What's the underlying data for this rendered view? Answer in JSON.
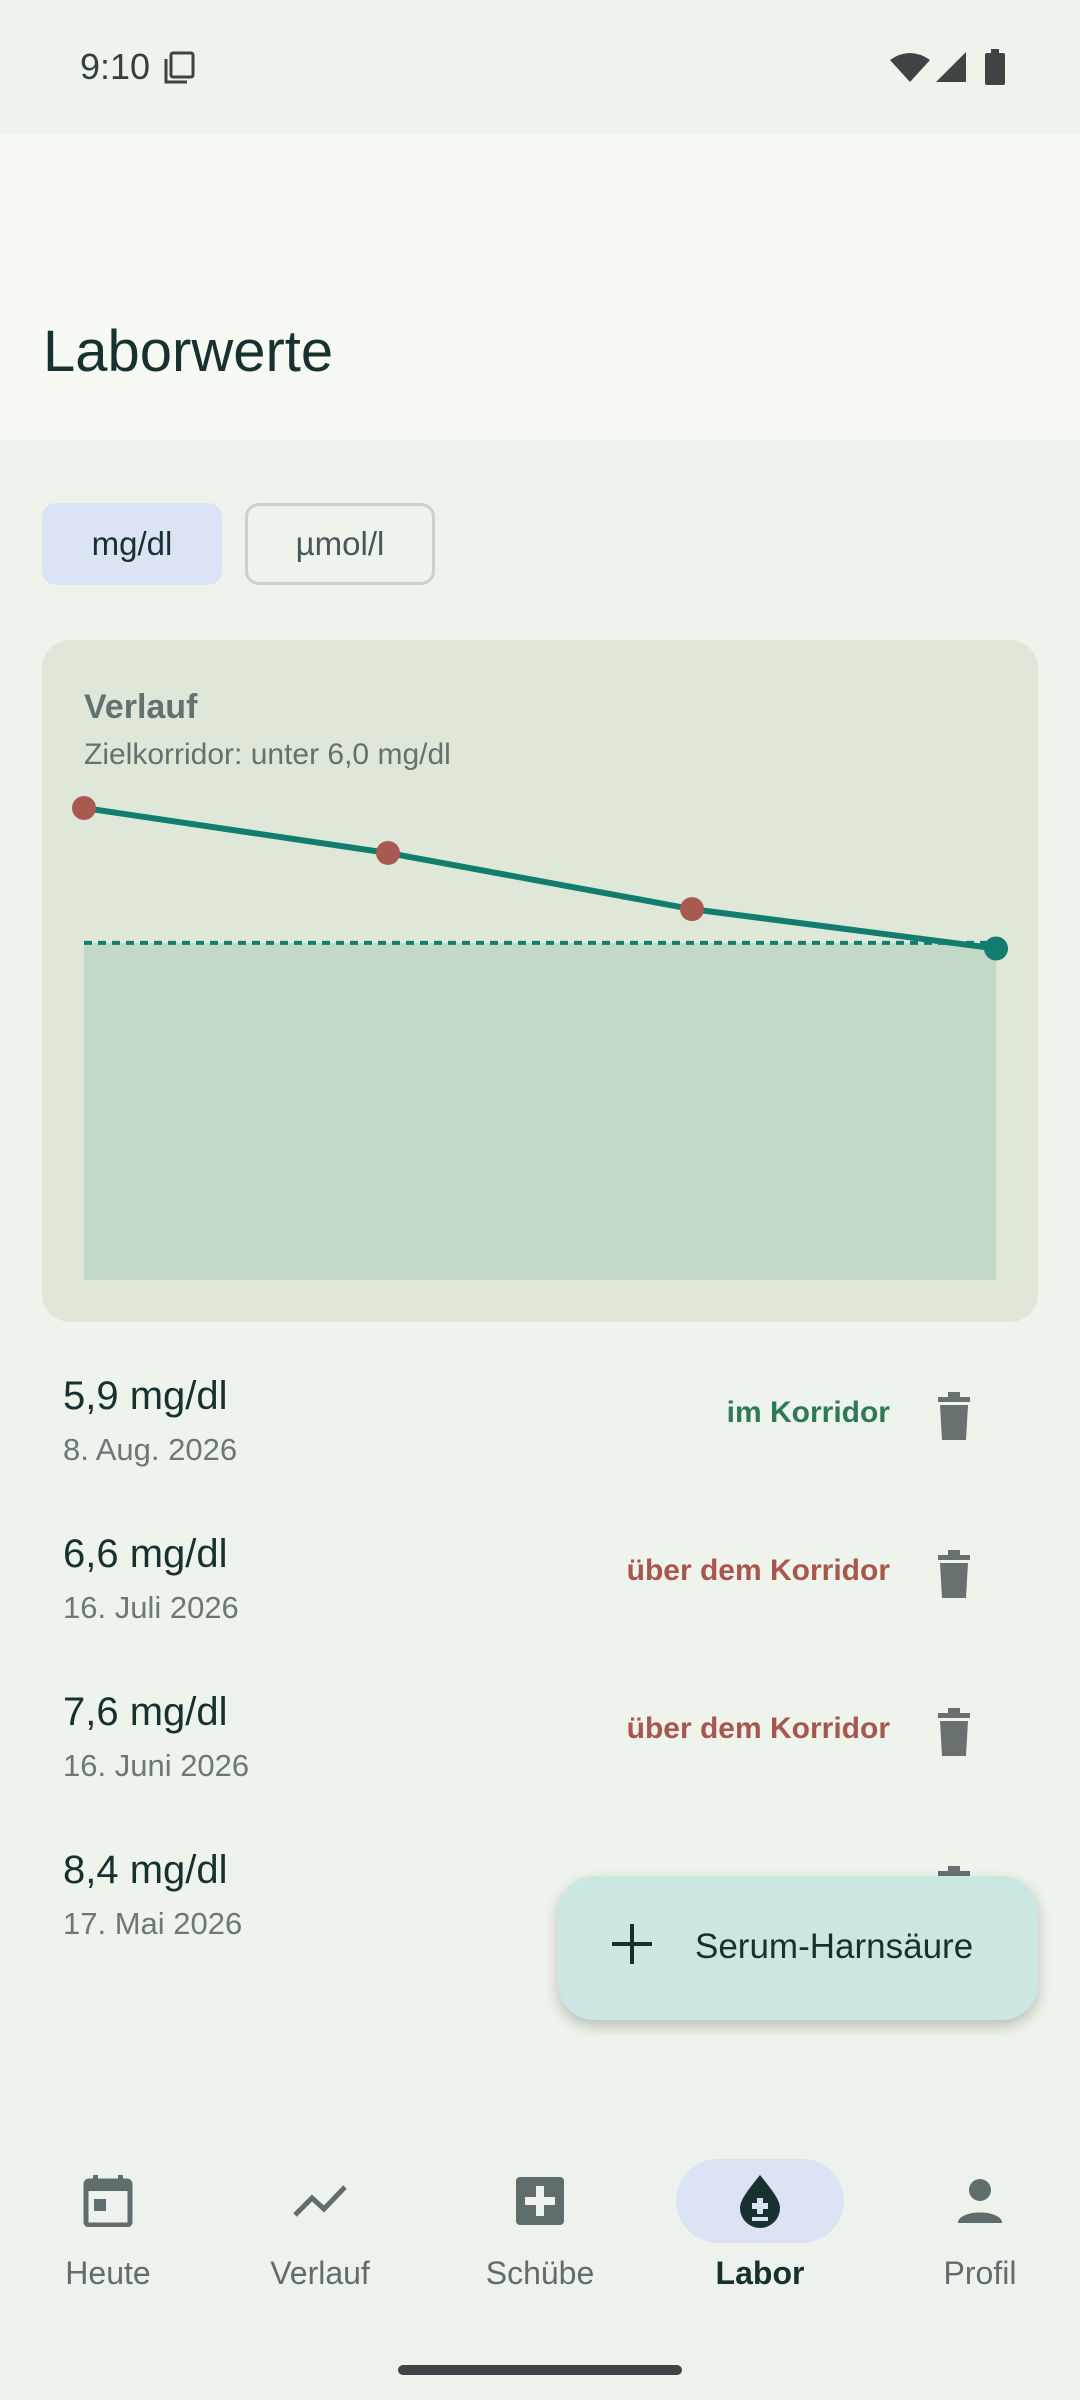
{
  "status": {
    "time": "9:10"
  },
  "header": {
    "title": "Laborwerte"
  },
  "unit_toggle": {
    "options": [
      "mg/dl",
      "µmol/l"
    ],
    "selected": "mg/dl"
  },
  "chart": {
    "title": "Verlauf",
    "subtitle": "Zielkorridor: unter 6,0 mg/dl"
  },
  "chart_data": {
    "type": "line",
    "x": [
      "17. Mai 2026",
      "16. Juni 2026",
      "16. Juli 2026",
      "8. Aug. 2026"
    ],
    "series": [
      {
        "values": [
          8.4,
          7.6,
          6.6,
          5.9
        ]
      }
    ],
    "target_max": 6.0,
    "ylim": [
      0,
      8.4
    ],
    "colors": {
      "line": "#127d6f",
      "above": "#a85a50",
      "in_range": "#127d6f",
      "target_band": "#c1d9c6"
    }
  },
  "entries": [
    {
      "value": "5,9 mg/dl",
      "date": "8. Aug. 2026",
      "status": "im Korridor",
      "state": "ok"
    },
    {
      "value": "6,6 mg/dl",
      "date": "16. Juli 2026",
      "status": "über dem Korridor",
      "state": "over"
    },
    {
      "value": "7,6 mg/dl",
      "date": "16. Juni 2026",
      "status": "über dem Korridor",
      "state": "over"
    },
    {
      "value": "8,4 mg/dl",
      "date": "17. Mai 2026",
      "status": "",
      "state": "over"
    }
  ],
  "fab": {
    "label": "Serum-Harnsäure",
    "icon": "plus-icon"
  },
  "nav": {
    "items": [
      {
        "label": "Heute",
        "icon": "calendar-icon"
      },
      {
        "label": "Verlauf",
        "icon": "trend-icon"
      },
      {
        "label": "Schübe",
        "icon": "medical-plus-icon"
      },
      {
        "label": "Labor",
        "icon": "drop-icon"
      },
      {
        "label": "Profil",
        "icon": "person-icon"
      }
    ],
    "active": "Labor"
  }
}
